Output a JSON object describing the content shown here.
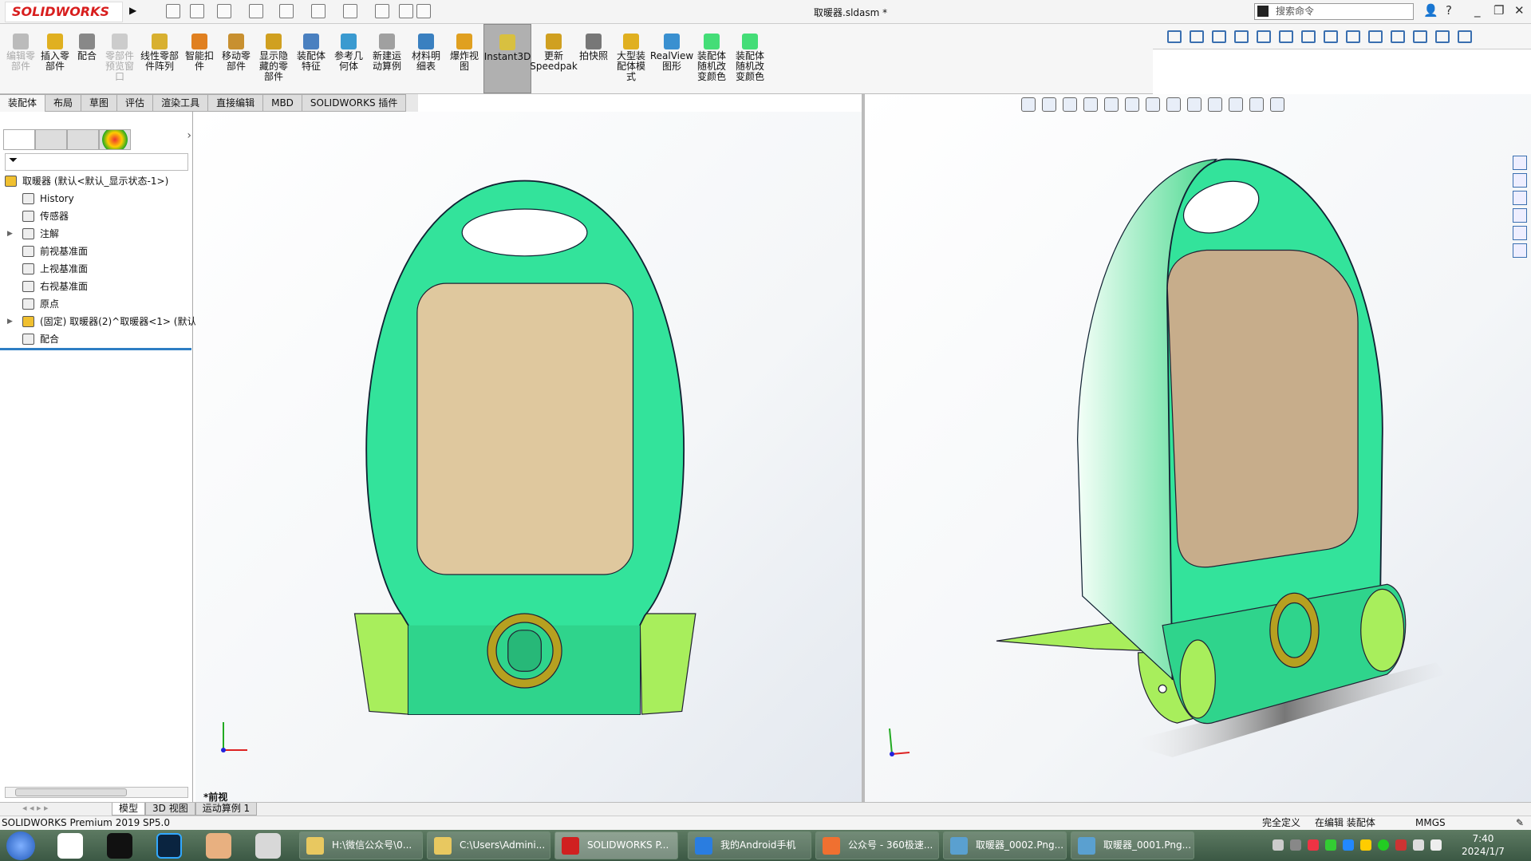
{
  "app": {
    "logo": "SOLIDWORKS",
    "doc_title": "取暖器.sldasm *",
    "search_placeholder": "搜索命令"
  },
  "ribbon": [
    {
      "label": "编辑零\n部件",
      "disabled": true,
      "color": "#bbbbbb"
    },
    {
      "label": "插入零\n部件",
      "color": "#e0b020"
    },
    {
      "label": "配合",
      "color": "#888888"
    },
    {
      "label": "零部件\n预览窗\n口",
      "disabled": true,
      "color": "#cccccc"
    },
    {
      "label": "线性零部\n件阵列",
      "color": "#d8b030"
    },
    {
      "label": "智能扣\n件",
      "color": "#e08020"
    },
    {
      "label": "移动零\n部件",
      "color": "#c89030"
    },
    {
      "label": "显示隐\n藏的零\n部件",
      "color": "#d0a020"
    },
    {
      "label": "装配体\n特征",
      "color": "#4a80c0"
    },
    {
      "label": "参考几\n何体",
      "color": "#3a9ad0"
    },
    {
      "label": "新建运\n动算例",
      "color": "#a0a0a0"
    },
    {
      "label": "材料明\n细表",
      "color": "#3a80c0"
    },
    {
      "label": "爆炸视\n图",
      "color": "#e0a020"
    },
    {
      "label": "Instant3D",
      "active": true,
      "color": "#d8c040"
    },
    {
      "label": "更新\nSpeedpak",
      "color": "#d0a020"
    },
    {
      "label": "拍快照",
      "color": "#777777"
    },
    {
      "label": "大型装\n配体模\n式",
      "color": "#e0b020"
    },
    {
      "label": "RealView\n图形",
      "color": "#3a90d0"
    },
    {
      "label": "装配体\n随机改\n变颜色",
      "color": "#44dd77"
    },
    {
      "label": "装配体\n随机改\n变颜色",
      "color": "#44dd77"
    }
  ],
  "tabs": [
    {
      "label": "装配体",
      "active": true
    },
    {
      "label": "布局"
    },
    {
      "label": "草图"
    },
    {
      "label": "评估"
    },
    {
      "label": "渲染工具"
    },
    {
      "label": "直接编辑"
    },
    {
      "label": "MBD"
    },
    {
      "label": "SOLIDWORKS 插件"
    }
  ],
  "tree": [
    {
      "label": "取暖器  (默认<默认_显示状态-1>)",
      "indent": 0,
      "icon": "assembly-icon"
    },
    {
      "label": "History",
      "indent": 1,
      "icon": "history-folder-icon"
    },
    {
      "label": "传感器",
      "indent": 1,
      "icon": "sensor-folder-icon"
    },
    {
      "label": "注解",
      "indent": 1,
      "icon": "annotation-folder-icon",
      "expandable": true
    },
    {
      "label": "前视基准面",
      "indent": 1,
      "icon": "plane-icon"
    },
    {
      "label": "上视基准面",
      "indent": 1,
      "icon": "plane-icon"
    },
    {
      "label": "右视基准面",
      "indent": 1,
      "icon": "plane-icon"
    },
    {
      "label": "原点",
      "indent": 1,
      "icon": "origin-icon"
    },
    {
      "label": "(固定) 取暖器(2)^取暖器<1> (默认",
      "indent": 1,
      "icon": "part-icon",
      "expandable": true
    },
    {
      "label": "配合",
      "indent": 1,
      "icon": "mates-icon"
    }
  ],
  "viewport": {
    "view_label": "*前视"
  },
  "bottom_tabs": [
    {
      "label": "模型",
      "active": true
    },
    {
      "label": "3D 视图"
    },
    {
      "label": "运动算例 1"
    }
  ],
  "status": {
    "product": "SOLIDWORKS Premium 2019 SP5.0",
    "definition": "完全定义",
    "mode": "在编辑 装配体",
    "units": "MMGS"
  },
  "taskbar": {
    "items": [
      {
        "label": "H:\\微信公众号\\0...",
        "color": "#e8c860"
      },
      {
        "label": "C:\\Users\\Admini...",
        "color": "#e8c860"
      },
      {
        "label": "SOLIDWORKS P...",
        "color": "#d02020",
        "active": true
      },
      {
        "label": "我的Android手机",
        "color": "#2a7de0"
      },
      {
        "label": "公众号 - 360极速...",
        "color": "#f07030"
      },
      {
        "label": "取暖器_0002.Png...",
        "color": "#5aa0d0"
      },
      {
        "label": "取暖器_0001.Png...",
        "color": "#5aa0d0"
      }
    ],
    "time": "7:40",
    "date": "2024/1/7"
  },
  "colors": {
    "body": "#33e39b",
    "panel": "#dfc89e",
    "foot": "#a8ee5c",
    "dial": "#b6a020"
  }
}
